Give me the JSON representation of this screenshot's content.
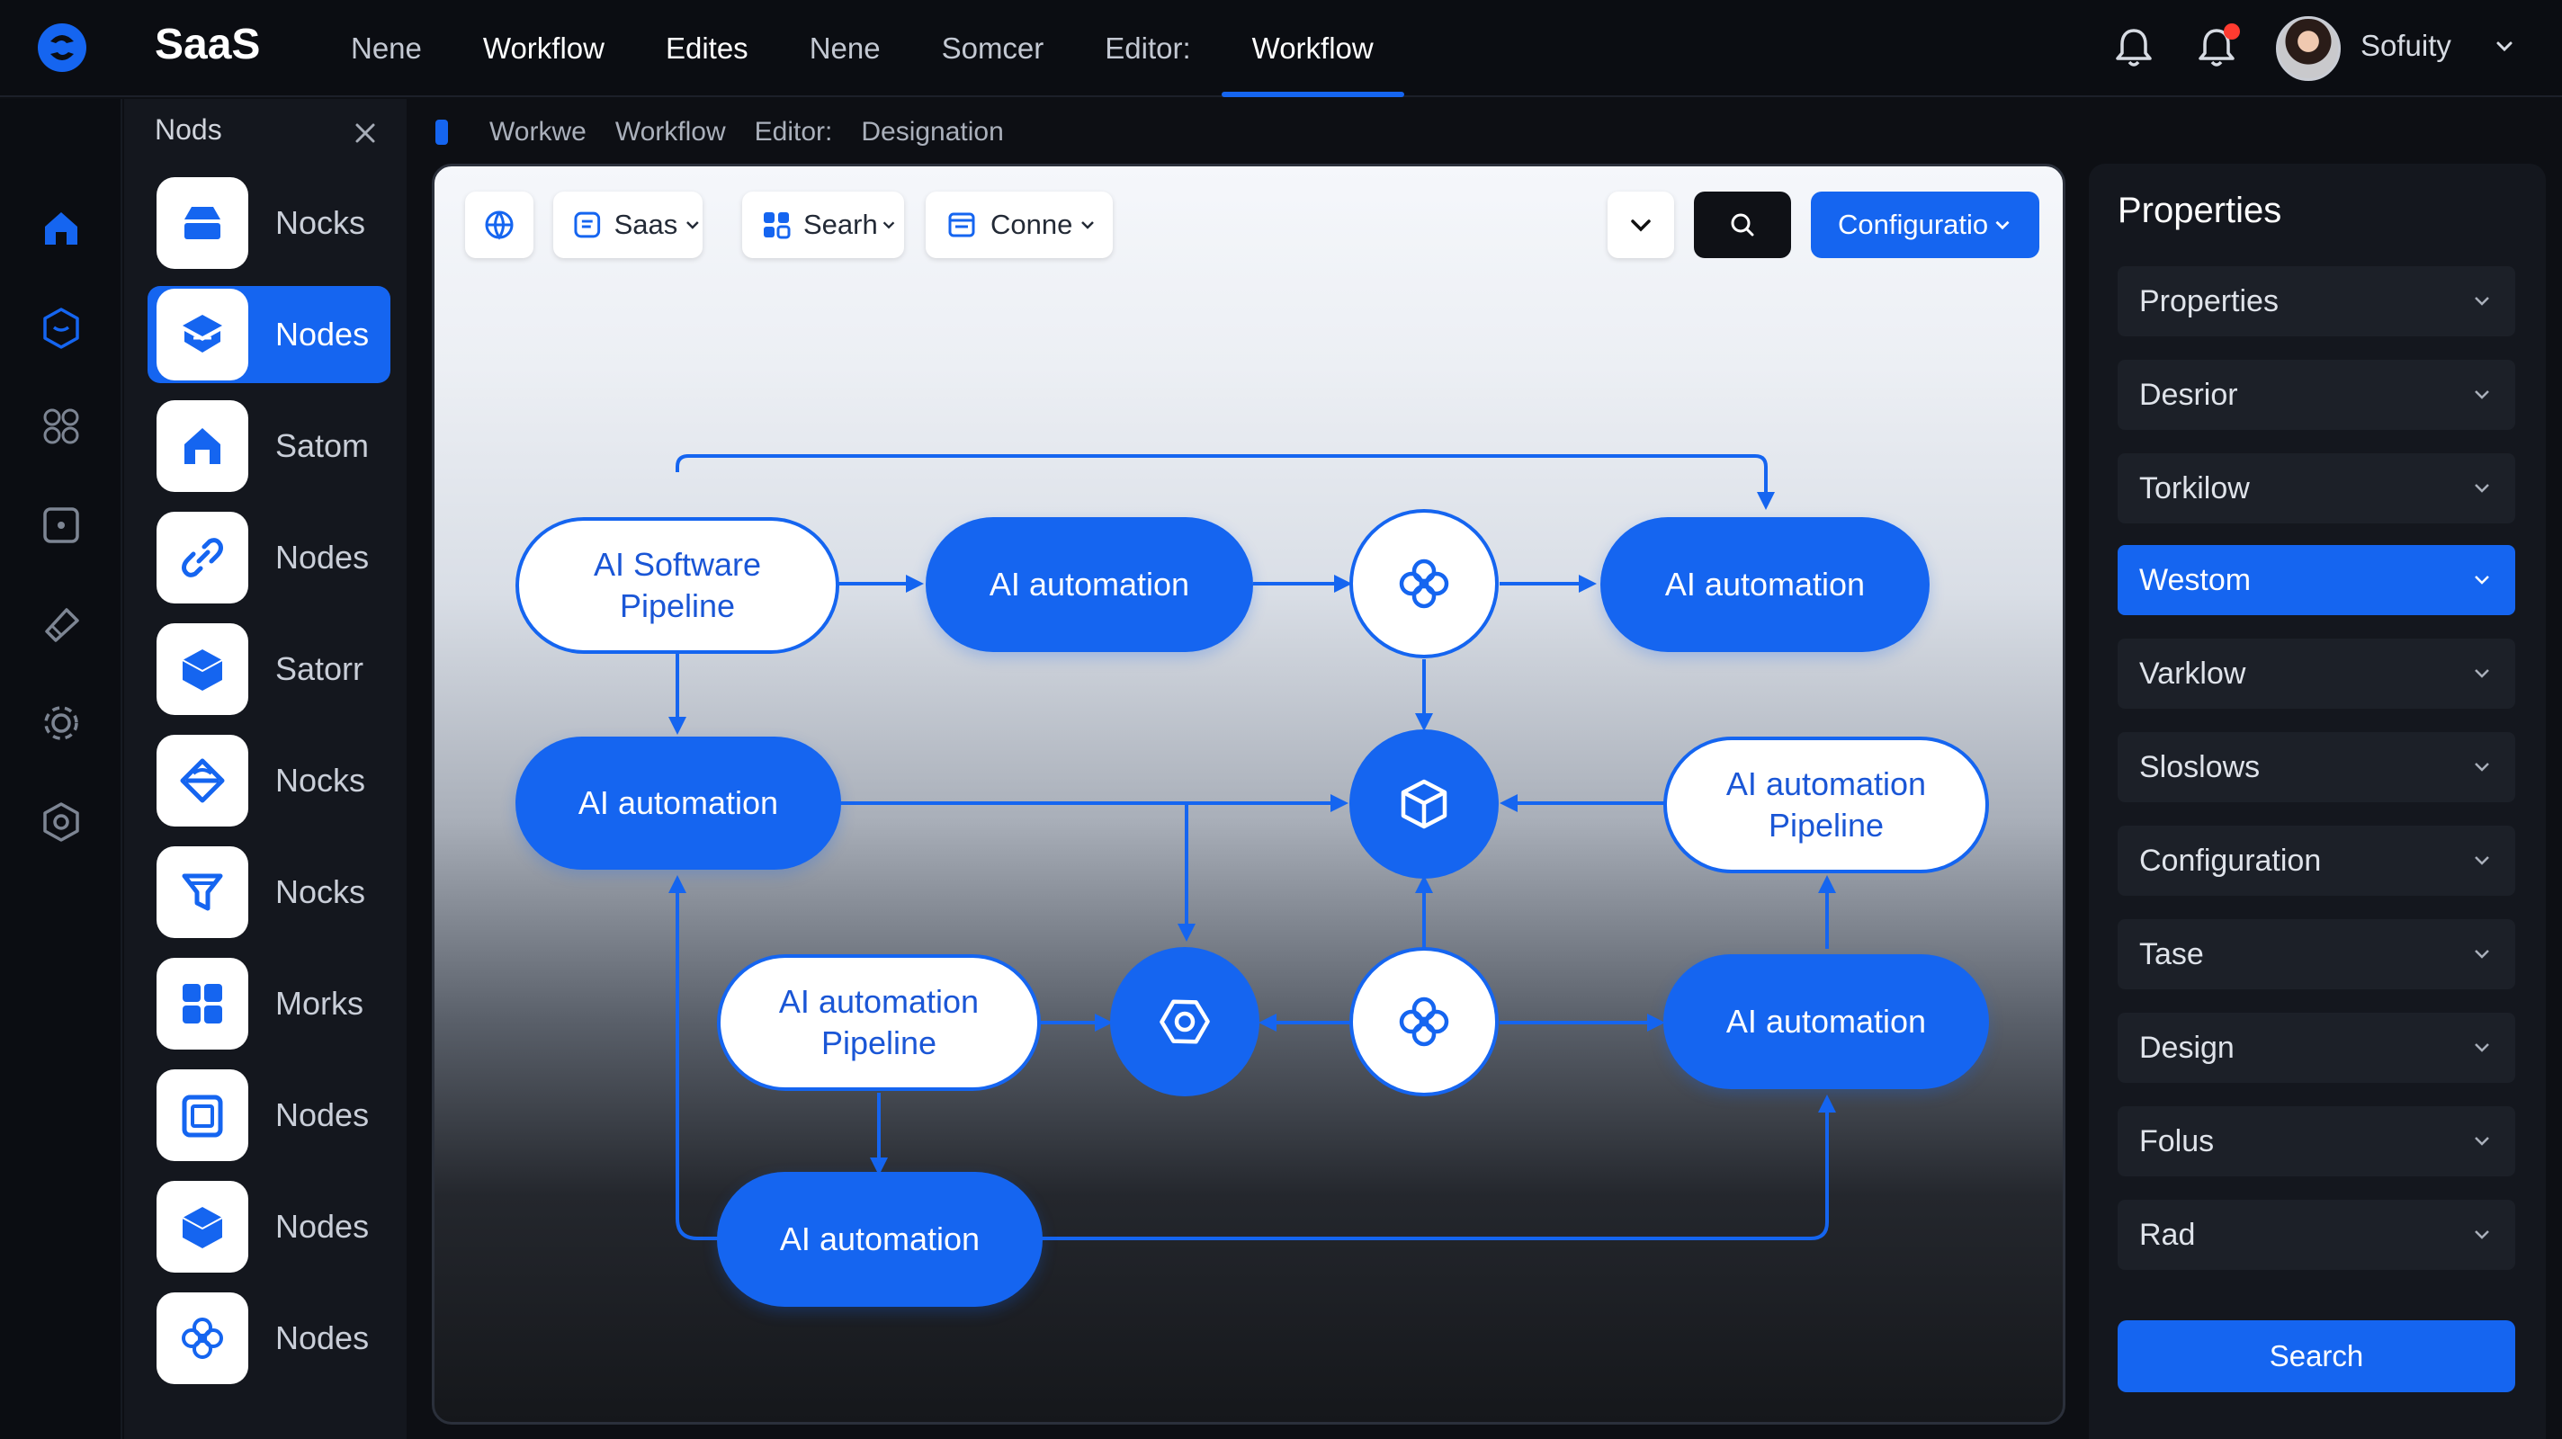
{
  "app": {
    "brand": "SaaS"
  },
  "nav": {
    "tabs": [
      {
        "label": "Nene"
      },
      {
        "label": "Workflow"
      },
      {
        "label": "Edites"
      },
      {
        "label": "Nene"
      },
      {
        "label": "Somcer"
      },
      {
        "label": "Editor:"
      },
      {
        "label": "Workflow"
      }
    ],
    "active_tab": "Workflow"
  },
  "user": {
    "name": "Sofuity",
    "icons": [
      "bell-icon",
      "bell-icon",
      "chevron-down-icon"
    ],
    "notification": true
  },
  "rail": {
    "icons": [
      "home-icon",
      "box-icon",
      "grid-icon",
      "square-dot-icon",
      "tag-icon",
      "gear-icon",
      "hexagon-gear-icon"
    ]
  },
  "nodes_panel": {
    "title": "Nods",
    "items": [
      {
        "label": "Nocks",
        "icon": "drawer-icon"
      },
      {
        "label": "Nodes",
        "icon": "stack-icon",
        "active": true
      },
      {
        "label": "Satom",
        "icon": "house-icon"
      },
      {
        "label": "Nodes",
        "icon": "link-icon"
      },
      {
        "label": "Satorr",
        "icon": "cube-icon"
      },
      {
        "label": "Nocks",
        "icon": "compass-icon"
      },
      {
        "label": "Nocks",
        "icon": "funnel-icon"
      },
      {
        "label": "Morks",
        "icon": "grid-icon"
      },
      {
        "label": "Nodes",
        "icon": "frame-icon"
      },
      {
        "label": "Nodes",
        "icon": "cube-icon"
      },
      {
        "label": "Nodes",
        "icon": "atom-icon"
      }
    ]
  },
  "breadcrumb": {
    "items": [
      "Workwe",
      "Workflow",
      "Editor:",
      "Designation"
    ]
  },
  "toolbar": {
    "saas": "Saas",
    "search": "Searh",
    "conne": "Conne",
    "config": "Configuratio",
    "icons": [
      "globe-icon",
      "saas-icon",
      "grid-icon",
      "list-icon",
      "chevron-down-icon",
      "search-icon"
    ]
  },
  "flow": {
    "nodes": {
      "n1": "AI Software\nPipeline",
      "n2": "AI automation",
      "n4": "AI automation",
      "n5": "AI automation",
      "n7": "AI automation\nPipeline",
      "n8": "AI automation\nPipeline",
      "n11": "AI automation",
      "n12": "AI automation"
    },
    "icons": [
      "atom-icon",
      "cube-icon",
      "hexagon-icon",
      "atom-icon"
    ]
  },
  "properties": {
    "title": "Properties",
    "rows": [
      {
        "label": "Properties"
      },
      {
        "label": "Desrior"
      },
      {
        "label": "Torkilow"
      },
      {
        "label": "Westom",
        "active": true
      },
      {
        "label": "Varklow"
      },
      {
        "label": "Sloslows"
      },
      {
        "label": "Configuration"
      },
      {
        "label": "Tase"
      },
      {
        "label": "Design"
      },
      {
        "label": "Folus"
      },
      {
        "label": "Rad"
      }
    ],
    "search_button": "Search"
  },
  "colors": {
    "accent": "#1565f0",
    "bg": "#0d0f14",
    "panel": "#14171e",
    "row": "#1c2028"
  }
}
